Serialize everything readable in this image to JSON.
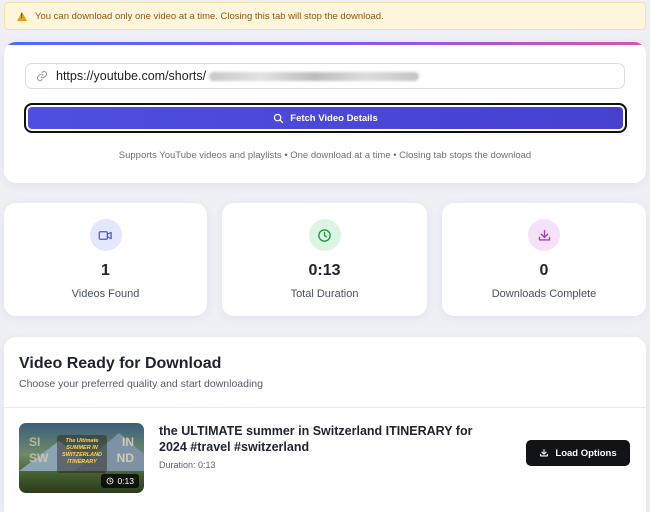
{
  "alert": {
    "icon": "warning-icon",
    "text": "You can download only one video at a time. Closing this tab will stop the download."
  },
  "search": {
    "url_value": "https://youtube.com/shorts/",
    "fetch_label": "Fetch Video Details",
    "support_text": "Supports YouTube videos and playlists • One download at a time • Closing tab stops the download"
  },
  "stats": [
    {
      "icon": "video-camera-icon",
      "value": "1",
      "label": "Videos Found",
      "color": "#4a56e2",
      "bg": "#e3e7ff"
    },
    {
      "icon": "clock-icon",
      "value": "0:13",
      "label": "Total Duration",
      "color": "#1e9a4b",
      "bg": "#dcf5e3"
    },
    {
      "icon": "download-icon",
      "value": "0",
      "label": "Downloads Complete",
      "color": "#a63fc0",
      "bg": "#f6e1fb"
    }
  ],
  "ready": {
    "title": "Video Ready for Download",
    "subtitle": "Choose your preferred quality and start downloading",
    "video": {
      "title": "the ULTIMATE summer in Switzerland ITINERARY for 2024 #travel #switzerland",
      "duration_text": "Duration: 0:13",
      "badge_duration": "0:13",
      "thumb_text": [
        "SI",
        "SW",
        "IN",
        "ND",
        "The Ultimate SUMMER IN SWITZERLAND ITINERARY"
      ]
    },
    "load_label": "Load Options"
  },
  "colors": {
    "accent": "#4e4fe0",
    "gradient": [
      "#4f6bf2",
      "#7a5cf0",
      "#e24fb6"
    ]
  }
}
